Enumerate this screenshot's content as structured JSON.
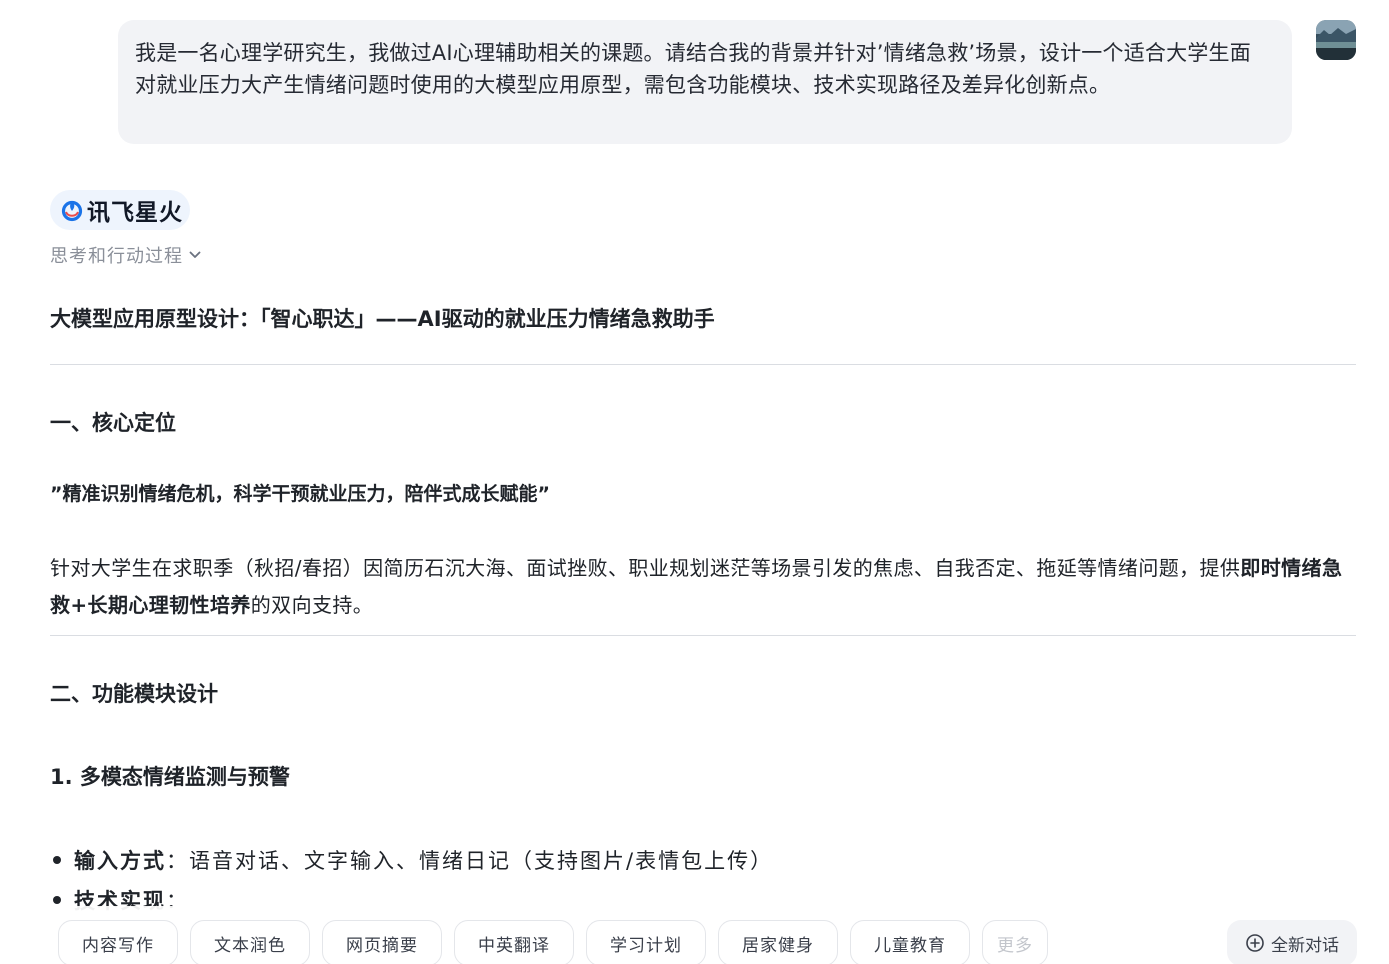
{
  "user_message": {
    "text": "我是一名心理学研究生，我做过AI心理辅助相关的课题。请结合我的背景并针对’情绪急救’场景，设计一个适合大学生面对就业压力大产生情绪问题时使用的大模型应用原型，需包含功能模块、技术实现路径及差异化创新点。"
  },
  "assistant": {
    "brand_name": "讯飞星火",
    "thinking_label": "思考和行动过程",
    "brand_color": "#1a73e8"
  },
  "doc": {
    "title": "大模型应用原型设计：「智心职达」——AI驱动的就业压力情绪急救助手",
    "section1_heading": "一、核心定位",
    "quote": "”精准识别情绪危机，科学干预就业压力，陪伴式成长赋能”",
    "para_part1": "针对大学生在求职季（秋招/春招）因简历石沉大海、面试挫败、职业规划迷茫等场景引发的焦虑、自我否定、拖延等情绪问题，提供",
    "para_bold": "即时情绪急救+长期心理韧性培养",
    "para_part2": "的双向支持。",
    "section2_heading": "二、功能模块设计",
    "subsection1_heading": "1. 多模态情绪监测与预警",
    "bullet1_label": "输入方式",
    "bullet1_sep": "：",
    "bullet1_text": "语音对话、文字输入、情绪日记（支持图片/表情包上传）",
    "bullet2_label": "技术实现",
    "bullet2_sep": "："
  },
  "quick_actions": [
    {
      "label": "内容写作"
    },
    {
      "label": "文本润色"
    },
    {
      "label": "网页摘要"
    },
    {
      "label": "中英翻译"
    },
    {
      "label": "学习计划"
    },
    {
      "label": "居家健身"
    },
    {
      "label": "儿童教育"
    },
    {
      "label": "更多"
    }
  ],
  "new_chat_label": "全新对话",
  "icons": {
    "thinking_toggle": "chevron-down-icon",
    "new_chat": "plus-circle-icon",
    "brand": "spark-logo-icon"
  }
}
